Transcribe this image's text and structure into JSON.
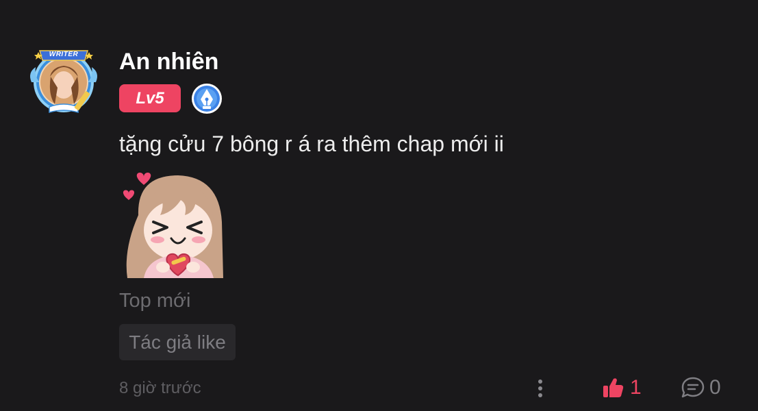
{
  "comment": {
    "avatar_frame_label": "WRITER",
    "username": "An nhiên",
    "level_badge": "Lv5",
    "role_badge_icon": "pen-nib-icon",
    "text": "tặng cửu 7 bông r á ra thêm chap mới ii",
    "sticker": "girl-with-heart-sticker",
    "tag_line": "Top mới",
    "author_like_label": "Tác giả like",
    "timestamp": "8 giờ trước",
    "like_count": "1",
    "reply_count": "0"
  },
  "colors": {
    "background": "#1a191b",
    "accent_pink": "#ee4462",
    "badge_blue": "#3b82e6",
    "muted_text": "#6d6c70"
  }
}
